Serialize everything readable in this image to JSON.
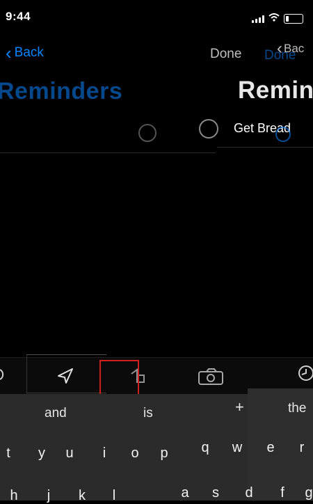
{
  "status": {
    "time": "9:44"
  },
  "nav": {
    "back_left": "Back",
    "done_left": "Done",
    "done_right": "Done",
    "back_right": "Bac"
  },
  "titles": {
    "ghost": "Reminders",
    "main": "Remin"
  },
  "reminder": {
    "text": "Get Bread"
  },
  "keyboard": {
    "suggestions_left": [
      "and",
      "is"
    ],
    "suggestions_right": [
      "the"
    ],
    "row1_left": [
      "t",
      "y",
      "u",
      "i",
      "o",
      "p"
    ],
    "row1_right": [
      "q",
      "w",
      "e",
      "r"
    ],
    "row2_left": [
      "h",
      "j",
      "k",
      "l"
    ],
    "row2_right": [
      "a",
      "s",
      "d",
      "f",
      "g"
    ]
  },
  "colors": {
    "accent": "#0a84ff",
    "highlight": "#d01f1f",
    "keyboard": "#2b2b2b"
  }
}
